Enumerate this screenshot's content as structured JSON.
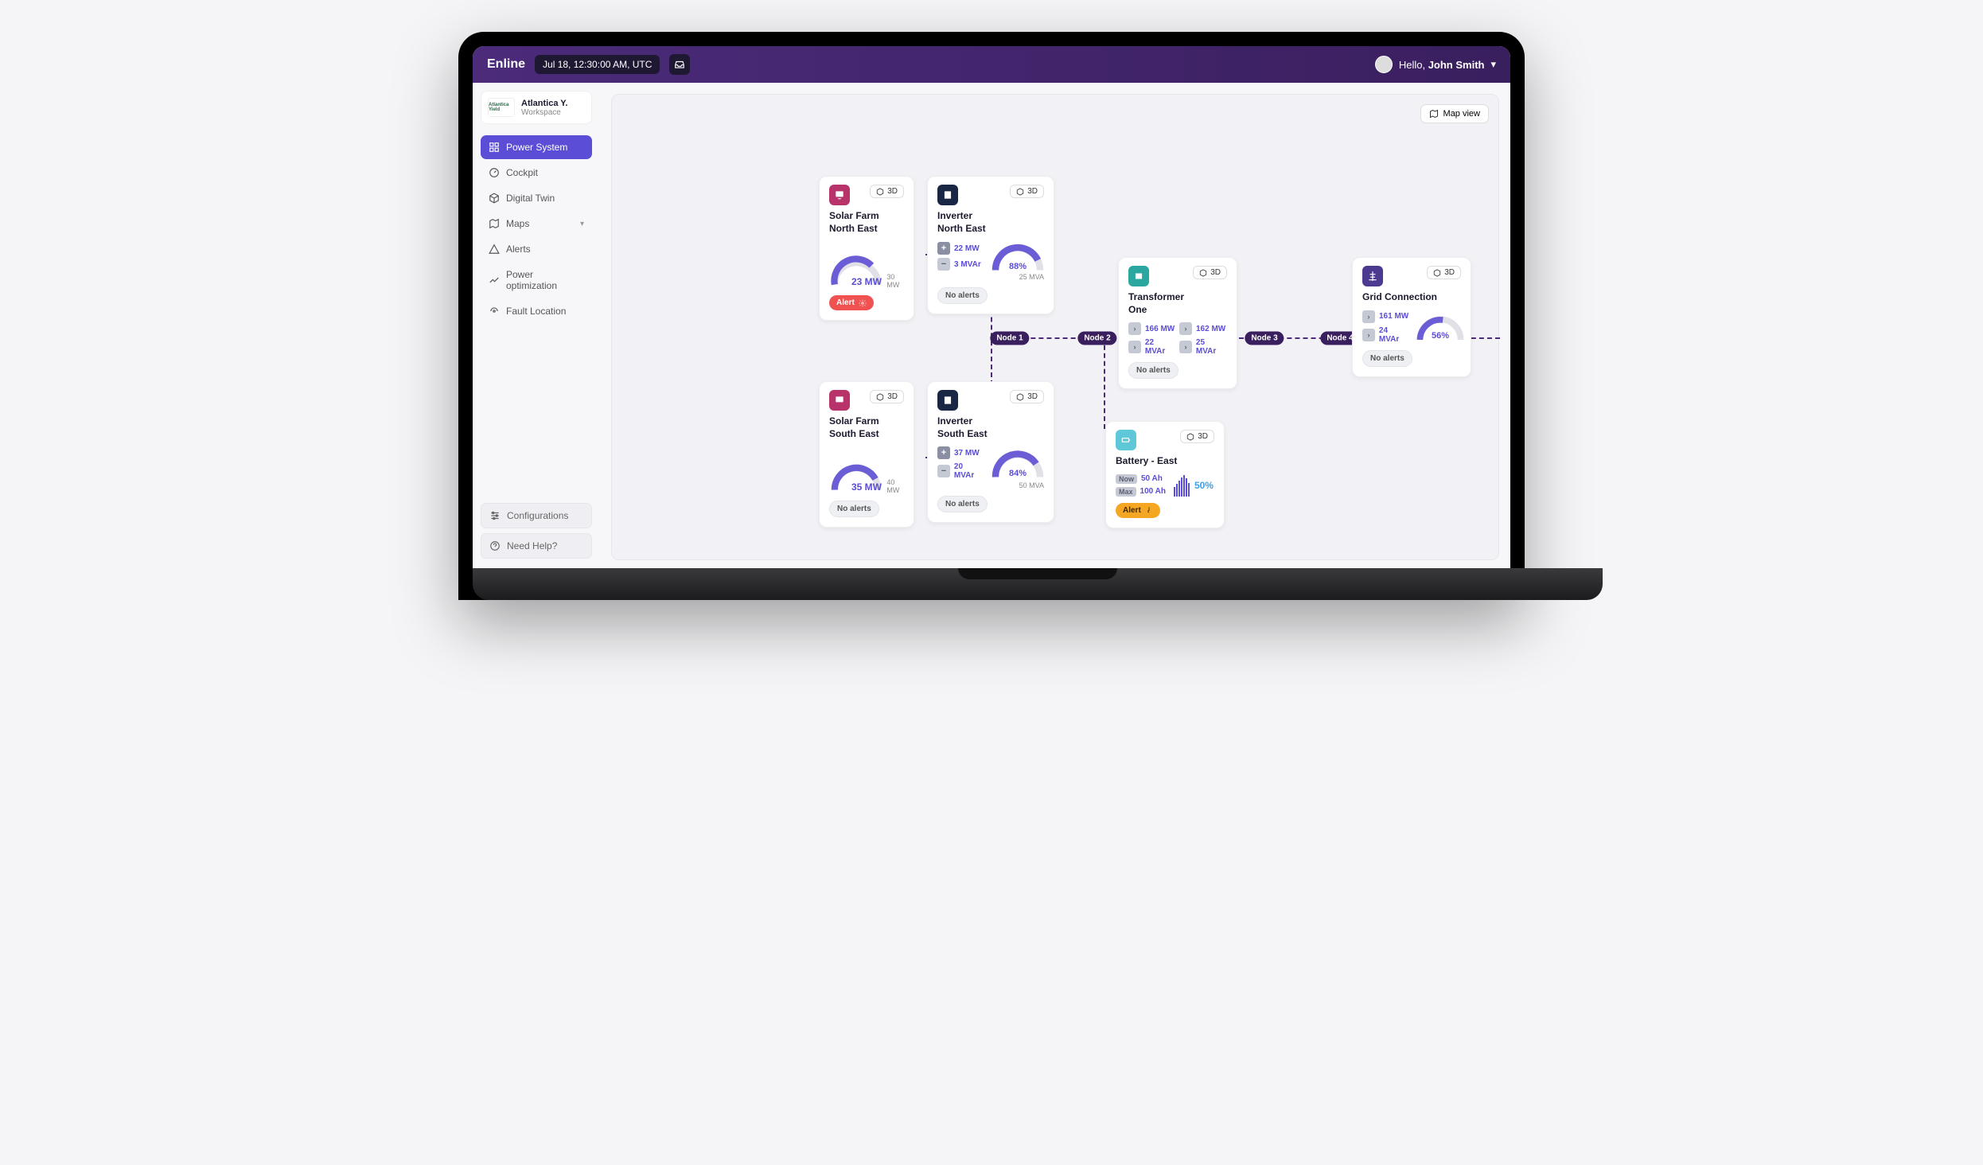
{
  "header": {
    "brand": "Enline",
    "timestamp": "Jul 18, 12:30:00 AM, UTC",
    "greeting_prefix": "Hello, ",
    "user_name": "John Smith"
  },
  "workspace": {
    "logo_text": "Atlantica Yield",
    "name": "Atlantica Y.",
    "sub": "Workspace"
  },
  "nav": {
    "items": [
      {
        "label": "Power System",
        "active": true
      },
      {
        "label": "Cockpit"
      },
      {
        "label": "Digital Twin"
      },
      {
        "label": "Maps",
        "expandable": true
      },
      {
        "label": "Alerts"
      },
      {
        "label": "Power optimization"
      },
      {
        "label": "Fault Location"
      }
    ],
    "bottom": [
      {
        "label": "Configurations"
      },
      {
        "label": "Need Help?"
      }
    ]
  },
  "canvas": {
    "map_view": "Map view",
    "three_d": "3D",
    "no_alerts": "No alerts",
    "alert": "Alert",
    "nodes": [
      "Node 1",
      "Node 2",
      "Node 3",
      "Node 4"
    ],
    "cards": {
      "solar_ne": {
        "title": "Solar Farm\nNorth East",
        "value": "23 MW",
        "max": "30 MW",
        "pct": 76,
        "alert": true
      },
      "solar_se": {
        "title": "Solar Farm\nSouth East",
        "value": "35 MW",
        "max": "40 MW",
        "pct": 87
      },
      "inv_ne": {
        "title": "Inverter\nNorth East",
        "p": "22 MW",
        "q": "3 MVAr",
        "pct": "88%",
        "max": "25 MVA"
      },
      "inv_se": {
        "title": "Inverter\nSouth East",
        "p": "37 MW",
        "q": "20 MVAr",
        "pct": "84%",
        "max": "50 MVA"
      },
      "xfmr": {
        "title": "Transformer\nOne",
        "stats": [
          "166 MW",
          "162 MW",
          "22 MVAr",
          "25 MVAr"
        ]
      },
      "grid": {
        "title": "Grid Connection",
        "p": "161 MW",
        "q": "24 MVAr",
        "pct": "56%"
      },
      "battery": {
        "title": "Battery - East",
        "now_lbl": "Now",
        "now": "50 Ah",
        "max_lbl": "Max",
        "max": "100 Ah",
        "pct": "50%",
        "alert": true
      }
    }
  }
}
